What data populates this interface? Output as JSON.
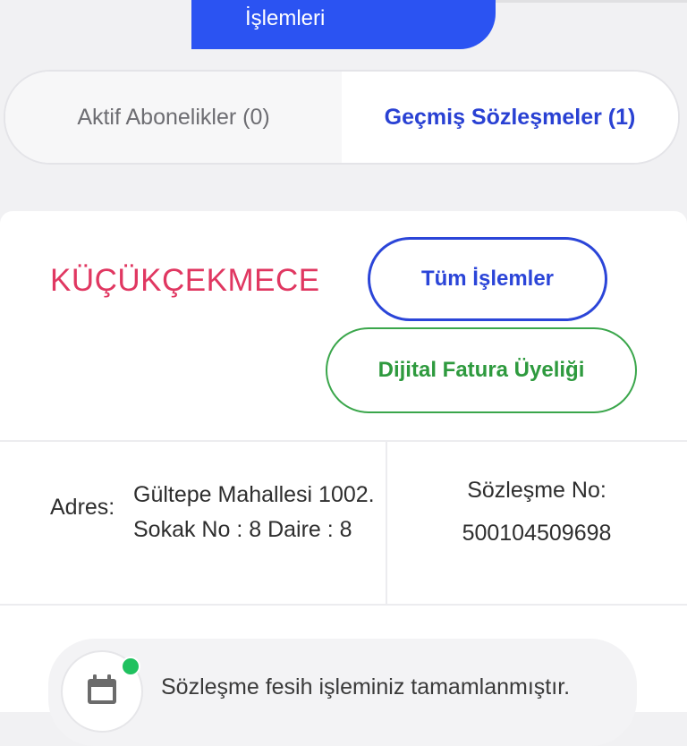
{
  "header": {
    "tab_label": "İşlemleri"
  },
  "tabs": [
    {
      "label": "Aktif Abonelikler (0)",
      "active": false
    },
    {
      "label": "Geçmiş Sözleşmeler (1)",
      "active": true
    }
  ],
  "card": {
    "district": "KÜÇÜKÇEKMECE",
    "all_operations_button": "Tüm İşlemler",
    "digital_invoice_button": "Dijital Fatura Üyeliği",
    "address_label": "Adres:",
    "address_line1": "Gültepe Mahallesi 1002.",
    "address_line2": "Sokak No : 8 Daire : 8",
    "contract_label": "Sözleşme No:",
    "contract_number": "500104509698"
  },
  "notice": {
    "text": "Sözleşme fesih işleminiz tamamlanmıştır.",
    "icon": "calendar-icon",
    "status_color": "#1fc15f"
  },
  "colors": {
    "accent_blue": "#2b53f2",
    "district_red": "#e03761",
    "digital_green": "#2e9a3e"
  }
}
